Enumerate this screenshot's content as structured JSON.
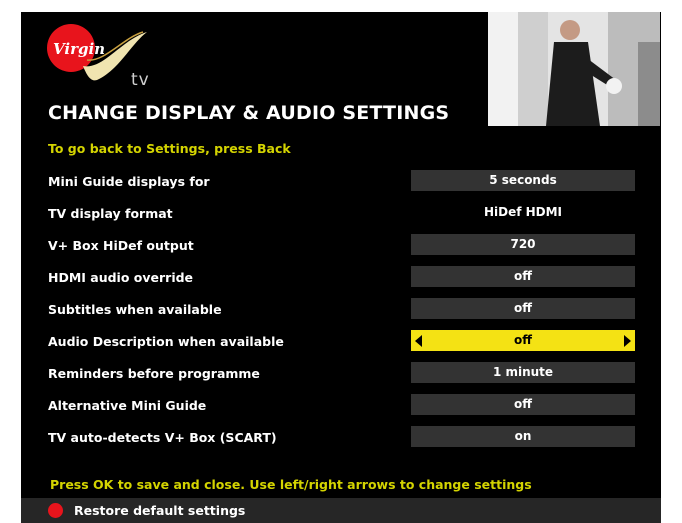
{
  "brand": {
    "logo_text": "tv",
    "logo_script": "Virgin",
    "accent_color": "#e8141c"
  },
  "page": {
    "title": "CHANGE DISPLAY & AUDIO SETTINGS",
    "back_hint": "To go back to Settings, press Back"
  },
  "settings": [
    {
      "label": "Mini Guide displays for",
      "value": "5 seconds"
    },
    {
      "label": "TV display format",
      "value": "HiDef HDMI"
    },
    {
      "label": "V+ Box HiDef output",
      "value": "720"
    },
    {
      "label": "HDMI audio override",
      "value": "off"
    },
    {
      "label": "Subtitles when available",
      "value": "off"
    },
    {
      "label": "Audio Description when available",
      "value": "off"
    },
    {
      "label": "Reminders before programme",
      "value": "1 minute"
    },
    {
      "label": "Alternative Mini Guide",
      "value": "off"
    },
    {
      "label": "TV auto-detects V+ Box (SCART)",
      "value": "on"
    }
  ],
  "footer": {
    "hint": "Press OK to save and close. Use left/right arrows to change settings",
    "restore_label": "Restore default settings"
  },
  "colors": {
    "background": "#000000",
    "hint_yellow": "#d4d400",
    "selected_yellow": "#f4e214",
    "value_box": "#333333"
  }
}
